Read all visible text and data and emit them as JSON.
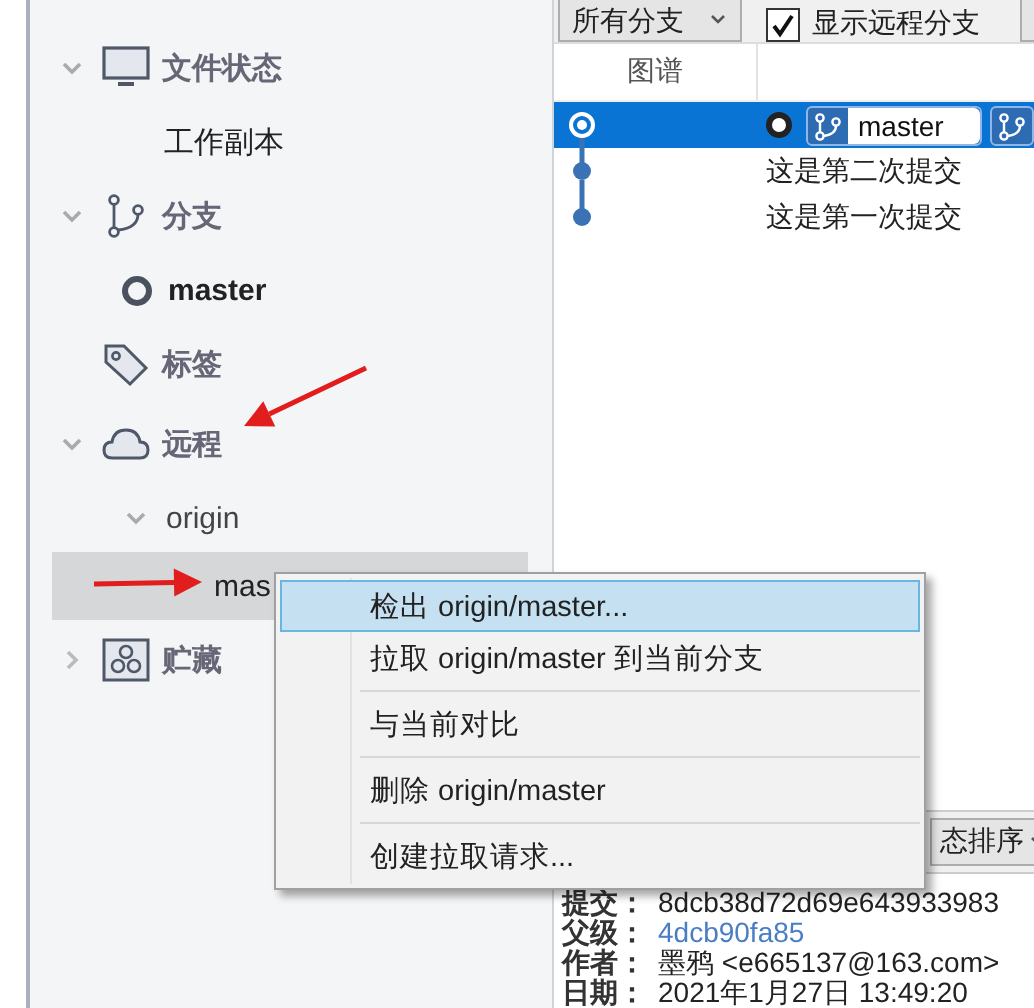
{
  "sidebar": {
    "sections": [
      {
        "label": "文件状态",
        "expanded": true,
        "children": [
          {
            "label": "工作副本"
          }
        ]
      },
      {
        "label": "分支",
        "expanded": true,
        "children": [
          {
            "label": "master",
            "current": true
          }
        ]
      },
      {
        "label": "标签"
      },
      {
        "label": "远程",
        "expanded": true,
        "children": [
          {
            "label": "origin",
            "expanded": true,
            "children": [
              {
                "label": "mas",
                "selected": true
              }
            ]
          }
        ]
      },
      {
        "label": "贮藏",
        "expanded": false
      }
    ]
  },
  "toolbar": {
    "branch_filter": "所有分支",
    "show_remote": {
      "label": "显示远程分支",
      "checked": true
    }
  },
  "graph": {
    "columns": [
      "图谱"
    ],
    "rows": [
      {
        "selected": true,
        "head": true,
        "tags": [
          {
            "kind": "local",
            "label": "master"
          },
          {
            "kind": "remote"
          }
        ]
      },
      {
        "selected": false,
        "message": "这是第二次提交"
      },
      {
        "selected": false,
        "message": "这是第一次提交"
      }
    ]
  },
  "file_toolbar": {
    "sort": "态排序"
  },
  "details": [
    {
      "label": "提交：",
      "value": "8dcb38d72d69e643933983"
    },
    {
      "label": "父级：",
      "value": "4dcb90fa85",
      "kind": "link"
    },
    {
      "label": "作者：",
      "value": "墨鸦 <e665137@163.com>"
    },
    {
      "label": "日期：",
      "value": "2021年1月27日 13:49:20"
    }
  ],
  "context_menu": {
    "items": [
      {
        "label": "检出 origin/master...",
        "selected": true
      },
      {
        "label": "拉取 origin/master 到当前分支",
        "selected": false,
        "separator_after": true
      },
      {
        "label": "与当前对比",
        "selected": false,
        "separator_after": true
      },
      {
        "label": "删除 origin/master",
        "selected": false,
        "separator_after": true
      },
      {
        "label": "创建拉取请求...",
        "selected": false
      }
    ]
  },
  "annotations": [
    {
      "kind": "arrow"
    },
    {
      "kind": "arrow"
    }
  ]
}
